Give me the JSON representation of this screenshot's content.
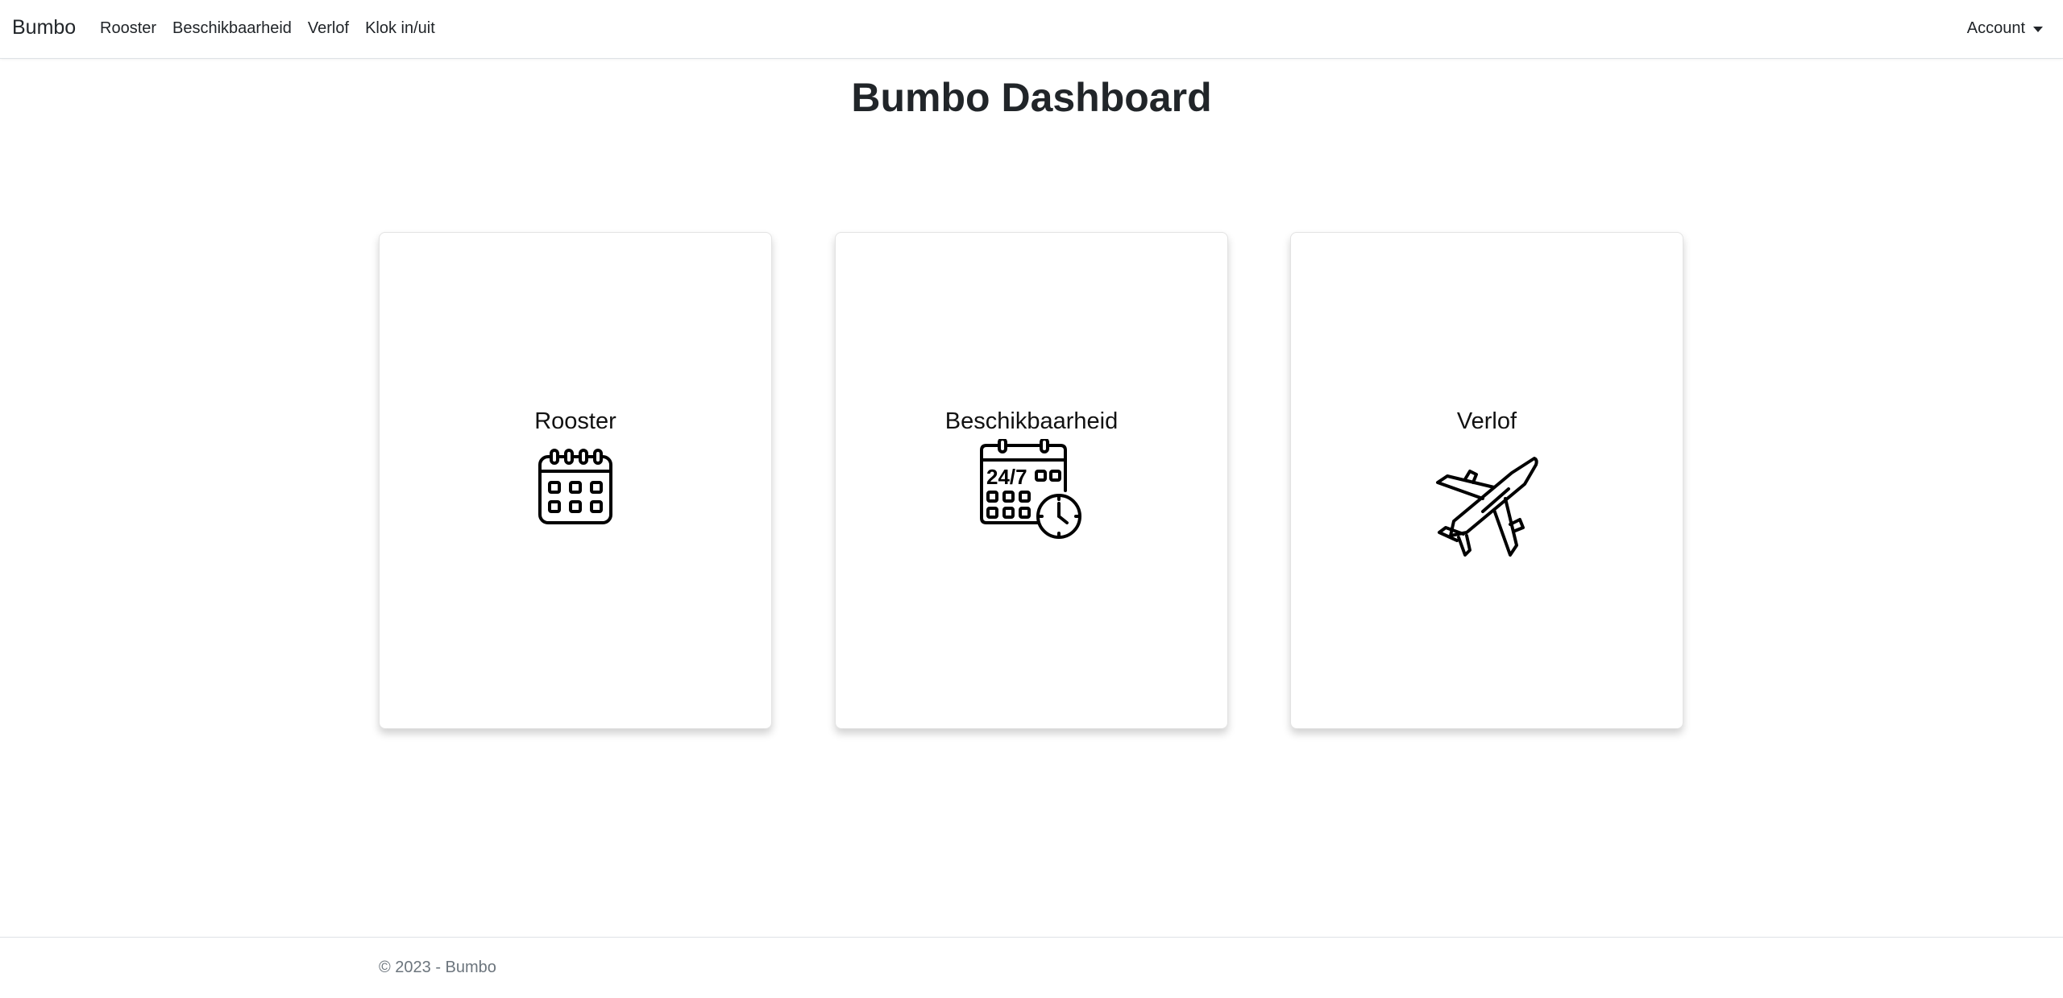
{
  "navbar": {
    "brand": "Bumbo",
    "links": [
      "Rooster",
      "Beschikbaarheid",
      "Verlof",
      "Klok in/uit"
    ],
    "account": "Account"
  },
  "page": {
    "title": "Bumbo Dashboard"
  },
  "cards": [
    {
      "label": "Rooster",
      "icon": "calendar-icon"
    },
    {
      "label": "Beschikbaarheid",
      "icon": "calendar-24-7-clock-icon"
    },
    {
      "label": "Verlof",
      "icon": "airplane-icon"
    }
  ],
  "footer": {
    "text": "© 2023 - Bumbo"
  },
  "colors": {
    "text": "#212529",
    "muted": "#6c757d",
    "border": "#dee2e6"
  }
}
